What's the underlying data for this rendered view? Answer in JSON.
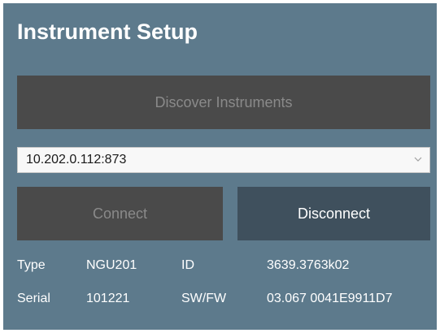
{
  "title": "Instrument Setup",
  "discover_button": "Discover Instruments",
  "address_combo": {
    "value": "10.202.0.112:873",
    "arrow_icon": "chevron-down-icon"
  },
  "connect_button": "Connect",
  "disconnect_button": "Disconnect",
  "info": {
    "type_label": "Type",
    "type_value": "NGU201",
    "id_label": "ID",
    "id_value": "3639.3763k02",
    "serial_label": "Serial",
    "serial_value": "101221",
    "swfw_label": "SW/FW",
    "swfw_value": "03.067 0041E9911D7"
  },
  "colors": {
    "panel_bg": "#5d7a8c",
    "disabled_button_bg": "#4a4a4a",
    "disabled_button_text": "#8a8a8a",
    "active_button_bg": "#3f505d",
    "text": "#ffffff"
  }
}
